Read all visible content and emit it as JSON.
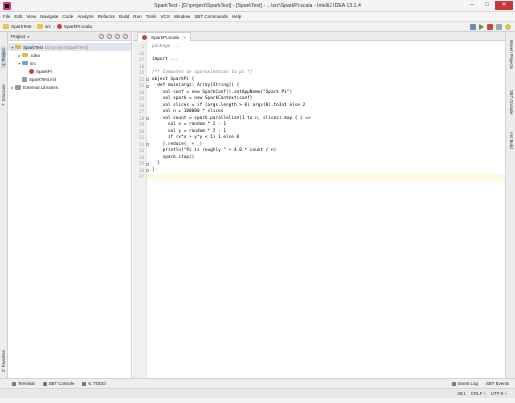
{
  "window": {
    "title": "SparkTest - [D:\\project\\SparkTest] - [SparkTest] - ...\\src\\SparkPi.scala - IntelliJ IDEA 13.1.4",
    "minimize": "–",
    "maximize": "□",
    "close": "✕"
  },
  "menu": [
    "File",
    "Edit",
    "View",
    "Navigate",
    "Code",
    "Analyze",
    "Refactor",
    "Build",
    "Run",
    "Tools",
    "VCS",
    "Window",
    "SBT Commands",
    "Help"
  ],
  "breadcrumb": {
    "project": "SparkTest",
    "folder": "src",
    "file": "SparkPi.scala"
  },
  "project_panel": {
    "title": "Project",
    "dropdown": "▾",
    "tree": [
      {
        "label": "SparkTest",
        "extra": "(D:\\project\\SparkTest)",
        "arrow": "▾",
        "icon": "folder",
        "indent": 0,
        "selected": true
      },
      {
        "label": ".idea",
        "extra": "",
        "arrow": "▸",
        "icon": "folder",
        "indent": 1,
        "selected": false
      },
      {
        "label": "src",
        "extra": "",
        "arrow": "▾",
        "icon": "folder-blue",
        "indent": 1,
        "selected": false
      },
      {
        "label": "SparkPi",
        "extra": "",
        "arrow": "",
        "icon": "scala",
        "indent": 2,
        "selected": false
      },
      {
        "label": "SparkTest.iml",
        "extra": "",
        "arrow": "",
        "icon": "iml",
        "indent": 1,
        "selected": false
      },
      {
        "label": "External Libraries",
        "extra": "",
        "arrow": "▸",
        "icon": "lib",
        "indent": 0,
        "selected": false
      }
    ]
  },
  "left_tabs": {
    "project": "1: Project",
    "structure": "7: Structure",
    "favorites": "2: Favorites"
  },
  "right_tabs": {
    "maven": "Maven Projects",
    "sbt": "SBT Console",
    "ant": "Ant Build"
  },
  "editor": {
    "tab_label": "SparkPi.scala",
    "tab_close": "×",
    "lines": [
      {
        "no": "1",
        "text": "package ...",
        "kind": "comment"
      },
      {
        "no": "16",
        "text": "",
        "kind": "code"
      },
      {
        "no": "17",
        "text": "import ...",
        "kind": "code"
      },
      {
        "no": "18",
        "text": "",
        "kind": "code"
      },
      {
        "no": "21",
        "text": "/** Computes an approximation to pi */",
        "kind": "comment"
      },
      {
        "no": "22",
        "text": "object SparkPi {",
        "kind": "code"
      },
      {
        "no": "23",
        "text": "  def main(args: Array[String]) {",
        "kind": "code"
      },
      {
        "no": "24",
        "text": "    val conf = new SparkConf().setAppName(\"Spark Pi\")",
        "kind": "code"
      },
      {
        "no": "25",
        "text": "    val spark = new SparkContext(conf)",
        "kind": "code"
      },
      {
        "no": "26",
        "text": "    val slices = if (args.length > 0) args(0).toInt else 2",
        "kind": "code"
      },
      {
        "no": "27",
        "text": "    val n = 100000 * slices",
        "kind": "code"
      },
      {
        "no": "28",
        "text": "    val count = spark.parallelize(1 to n, slices).map { i =>",
        "kind": "code"
      },
      {
        "no": "29",
        "text": "      val x = random * 2 - 1",
        "kind": "code"
      },
      {
        "no": "30",
        "text": "      val y = random * 2 - 1",
        "kind": "code"
      },
      {
        "no": "31",
        "text": "      if (x*x + y*y < 1) 1 else 0",
        "kind": "code"
      },
      {
        "no": "32",
        "text": "    }.reduce(_ + _)",
        "kind": "code"
      },
      {
        "no": "33",
        "text": "    println(\"Pi is roughly \" + 4.0 * count / n)",
        "kind": "code"
      },
      {
        "no": "34",
        "text": "    spark.stop()",
        "kind": "code"
      },
      {
        "no": "35",
        "text": "  }",
        "kind": "code"
      },
      {
        "no": "36",
        "text": "}",
        "kind": "code"
      },
      {
        "no": "37",
        "text": "",
        "kind": "current"
      }
    ]
  },
  "bottom_tabs": {
    "terminal": "Terminal",
    "sbt_console": "SBT Console",
    "todo": "6: TODO"
  },
  "bottom_right": {
    "event_log": "Event Log",
    "sbt_events": "SBT Events"
  },
  "status": {
    "position": "38:1",
    "line_sep": "CRLF ÷",
    "encoding": "UTF-8 ÷"
  },
  "colors": {
    "accent": "#c9d7ea",
    "current_line": "#fffae3",
    "close": "#c7383a"
  }
}
